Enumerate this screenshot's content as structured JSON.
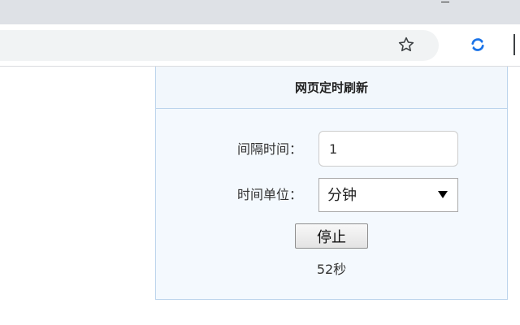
{
  "browser": {
    "bookmark_icon": "star-outline-icon",
    "extension_icon": "refresh-extension-icon",
    "extension_icon_color": "#1a73e8"
  },
  "popup": {
    "title": "网页定时刷新",
    "interval": {
      "label": "间隔时间：",
      "value": "1"
    },
    "unit": {
      "label": "时间单位：",
      "selected": "分钟"
    },
    "stop_button": "停止",
    "countdown": "52秒",
    "colors": {
      "border": "#bcd4ec",
      "background": "#f4f9fe"
    }
  }
}
